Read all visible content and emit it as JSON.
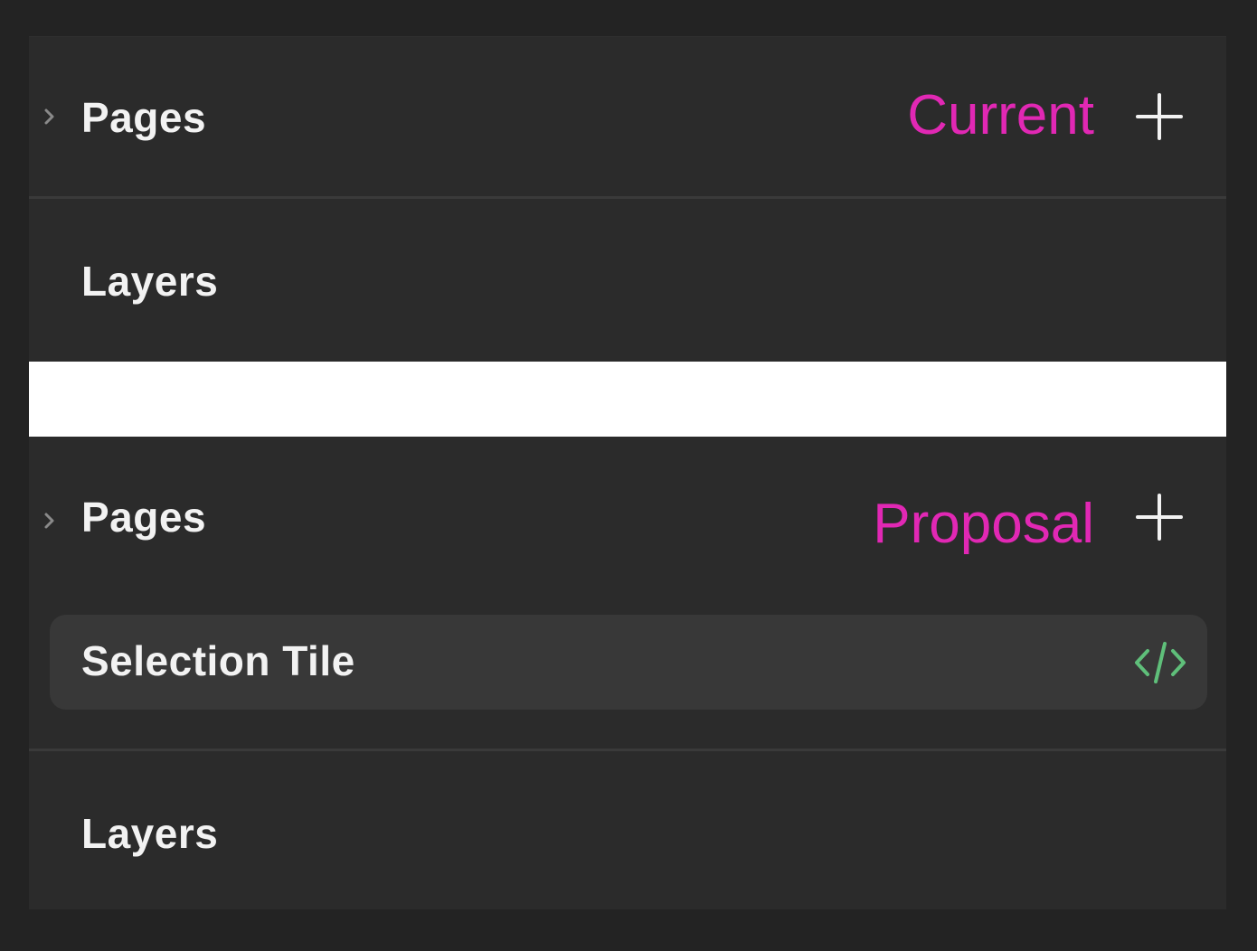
{
  "current": {
    "annotation": "Current",
    "pages_label": "Pages",
    "layers_label": "Layers"
  },
  "proposal": {
    "annotation": "Proposal",
    "pages_label": "Pages",
    "selection_tile_label": "Selection Tile",
    "layers_label": "Layers"
  },
  "icons": {
    "chevron": "chevron-right-icon",
    "add": "plus-icon",
    "code": "code-icon"
  },
  "colors": {
    "annotation": "#e128b4",
    "code_icon": "#5fbf7a",
    "background": "#2b2b2b",
    "tile": "#383838"
  }
}
